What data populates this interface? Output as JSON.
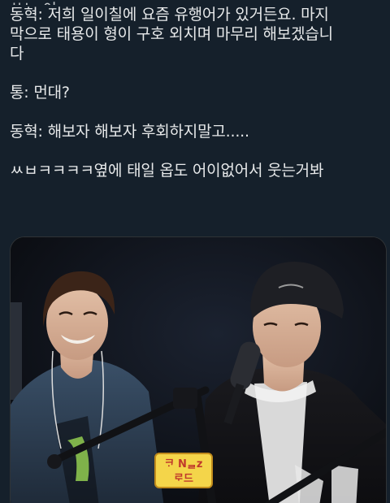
{
  "tweet": {
    "lines": [
      "ᄊᄂᆞ 이..",
      "동혁: 저희 일이칠에 요즘 유행어가 있거든요. 마지",
      "막으로 태용이 형이 구호 외치며 마무리 해보겠습니",
      "다",
      "",
      "통: 먼대?",
      "",
      "동혁: 해보자 해보자 후회하지말고.....",
      "",
      "ㅆㅂㅋㅋㅋㅋ옆에 태일 옵도 어이없어서 웃는거봐"
    ]
  },
  "media": {
    "description_icon": "photo",
    "sign_line1": "ᄏᆞ Nᆯz",
    "sign_line2": "ᄅᆞ드"
  }
}
